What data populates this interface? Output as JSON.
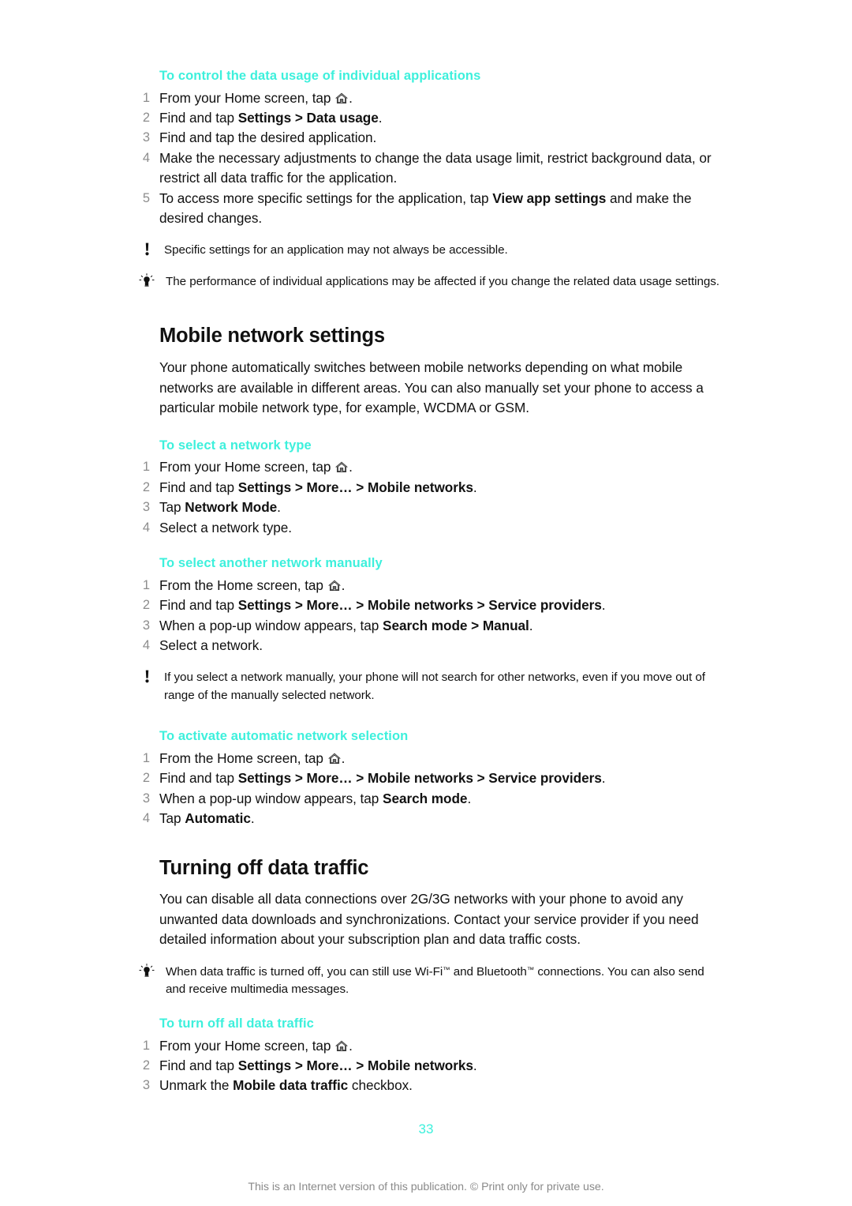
{
  "document": {
    "page_number": "33",
    "footer_note": "This is an Internet version of this publication. © Print only for private use.",
    "accent_color": "#3DF0DC",
    "body_color": "#111111",
    "number_color": "#8D8D8D"
  },
  "sections": {
    "control_data_usage": {
      "heading": "To control the data usage of individual applications",
      "steps": [
        {
          "num": "1",
          "pre": "From your Home screen, tap ",
          "icon": "home-icon",
          "post": "."
        },
        {
          "num": "2",
          "pre": "Find and tap ",
          "bold": "Settings > Data usage",
          "post": "."
        },
        {
          "num": "3",
          "pre": "Find and tap the desired application.",
          "bold": "",
          "post": ""
        },
        {
          "num": "4",
          "pre": "Make the necessary adjustments to change the data usage limit, restrict background data, or restrict all data traffic for the application.",
          "bold": "",
          "post": ""
        },
        {
          "num": "5",
          "pre": "To access more specific settings for the application, tap ",
          "bold": "View app settings",
          "post": " and make the desired changes."
        }
      ],
      "note_warning": "Specific settings for an application may not always be accessible.",
      "note_tip": "The performance of individual applications may be affected if you change the related data usage settings."
    },
    "mobile_network_settings": {
      "heading": "Mobile network settings",
      "intro": "Your phone automatically switches between mobile networks depending on what mobile networks are available in different areas. You can also manually set your phone to access a particular mobile network type, for example, WCDMA or GSM."
    },
    "select_network_type": {
      "heading": "To select a network type",
      "steps": [
        {
          "num": "1",
          "pre": "From your Home screen, tap ",
          "icon": "home-icon",
          "post": "."
        },
        {
          "num": "2",
          "pre": "Find and tap ",
          "bold": "Settings > More… > Mobile networks",
          "post": "."
        },
        {
          "num": "3",
          "pre": "Tap ",
          "bold": "Network Mode",
          "post": "."
        },
        {
          "num": "4",
          "pre": "Select a network type.",
          "bold": "",
          "post": ""
        }
      ]
    },
    "select_network_manually": {
      "heading": "To select another network manually",
      "steps": [
        {
          "num": "1",
          "pre": "From the Home screen, tap ",
          "icon": "home-icon",
          "post": "."
        },
        {
          "num": "2",
          "pre": "Find and tap ",
          "bold": "Settings > More… > Mobile networks > Service providers",
          "post": "."
        },
        {
          "num": "3",
          "pre": "When a pop-up window appears, tap ",
          "bold": "Search mode > Manual",
          "post": "."
        },
        {
          "num": "4",
          "pre": "Select a network.",
          "bold": "",
          "post": ""
        }
      ],
      "note_warning": "If you select a network manually, your phone will not search for other networks, even if you move out of range of the manually selected network."
    },
    "activate_automatic_selection": {
      "heading": "To activate automatic network selection",
      "steps": [
        {
          "num": "1",
          "pre": "From the Home screen, tap ",
          "icon": "home-icon",
          "post": "."
        },
        {
          "num": "2",
          "pre": "Find and tap ",
          "bold": "Settings > More… > Mobile networks > Service providers",
          "post": "."
        },
        {
          "num": "3",
          "pre": "When a pop-up window appears, tap ",
          "bold": "Search mode",
          "post": "."
        },
        {
          "num": "4",
          "pre": "Tap ",
          "bold": "Automatic",
          "post": "."
        }
      ]
    },
    "turning_off_data_traffic": {
      "heading": "Turning off data traffic",
      "intro": "You can disable all data connections over 2G/3G networks with your phone to avoid any unwanted data downloads and synchronizations. Contact your service provider if you need detailed information about your subscription plan and data traffic costs.",
      "note_tip_pre": "When data traffic is turned off, you can still use Wi-Fi",
      "note_tip_mid": " and Bluetooth",
      "note_tip_post": " connections. You can also send and receive multimedia messages.",
      "trademark": "™"
    },
    "turn_off_all_data_traffic": {
      "heading": "To turn off all data traffic",
      "steps": [
        {
          "num": "1",
          "pre": "From your Home screen, tap ",
          "icon": "home-icon",
          "post": "."
        },
        {
          "num": "2",
          "pre": "Find and tap ",
          "bold": "Settings > More… > Mobile networks",
          "post": "."
        },
        {
          "num": "3",
          "pre": "Unmark the ",
          "bold": "Mobile data traffic",
          "post": " checkbox."
        }
      ]
    }
  }
}
